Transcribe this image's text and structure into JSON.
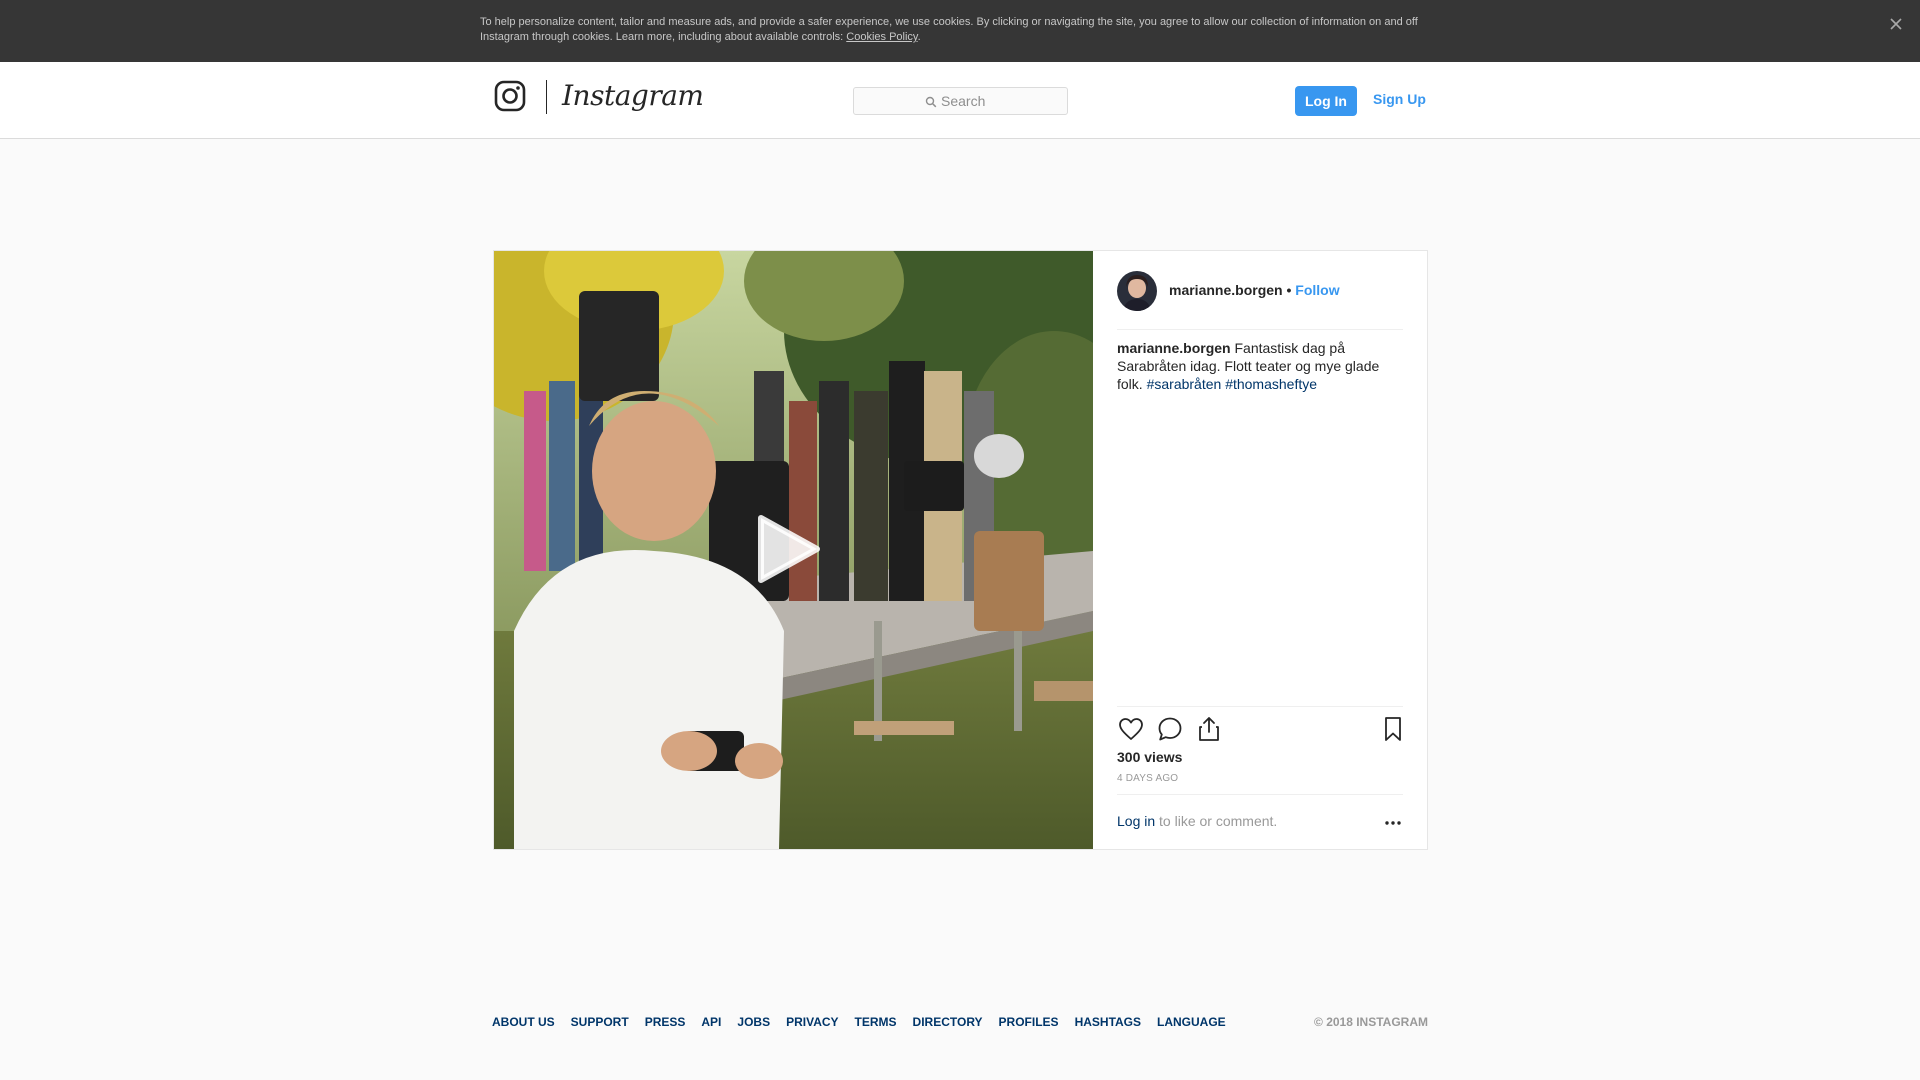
{
  "cookie_banner": {
    "text": "To help personalize content, tailor and measure ads, and provide a safer experience, we use cookies. By clicking or navigating the site, you agree to allow our collection of information on and off Instagram through cookies. Learn more, including about available controls: ",
    "link": "Cookies Policy",
    "end": "."
  },
  "header": {
    "logo_text": "Instagram",
    "search_placeholder": "Search",
    "login_label": "Log In",
    "signup_label": "Sign Up"
  },
  "post": {
    "username": "marianne.borgen",
    "dot": "•",
    "follow_label": "Follow",
    "caption_text": " Fantastisk dag på Sarabråten idag. Flott teater og mye glade folk. ",
    "hashtags": [
      "#sarabråten",
      "#thomasheftye"
    ],
    "views": "300 views",
    "timestamp": "4 DAYS AGO",
    "login_prompt_link": "Log in",
    "login_prompt_text": " to like or comment.",
    "more_label": "...",
    "icons": [
      "heart-icon",
      "comment-icon",
      "share-icon",
      "bookmark-icon",
      "play-icon"
    ]
  },
  "footer": {
    "links": [
      "ABOUT US",
      "SUPPORT",
      "PRESS",
      "API",
      "JOBS",
      "PRIVACY",
      "TERMS",
      "DIRECTORY",
      "PROFILES",
      "HASHTAGS",
      "LANGUAGE"
    ],
    "copyright": "© 2018 INSTAGRAM"
  },
  "colors": {
    "accent": "#3897f0",
    "link_dark": "#003569",
    "banner_bg": "#363636",
    "page_bg": "#fafafa"
  }
}
